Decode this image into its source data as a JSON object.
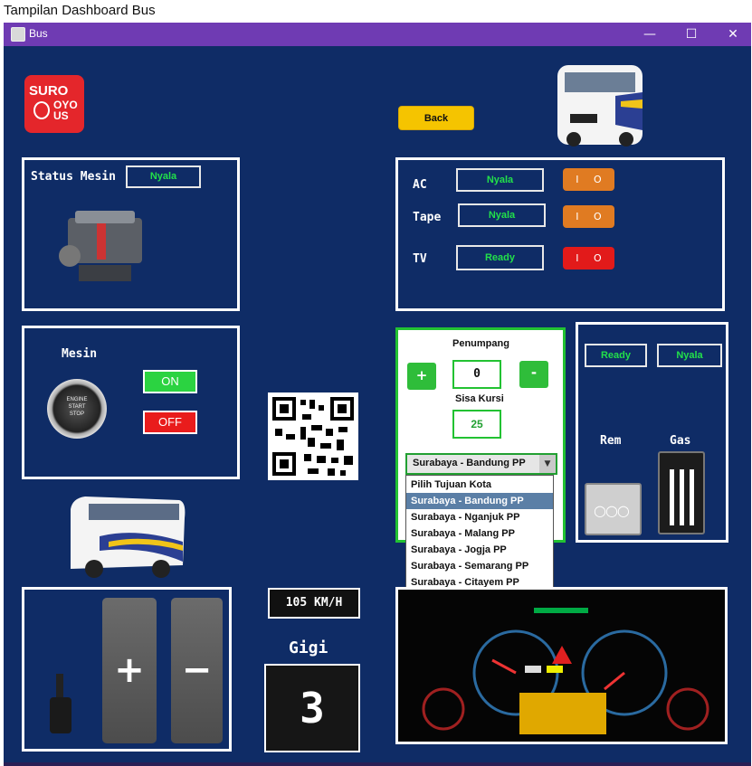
{
  "outer_title": "Tampilan Dashboard Bus",
  "window": {
    "title": "Bus",
    "minimize": "—",
    "maximize": "☐",
    "close": "✕"
  },
  "logo": {
    "line1": "SURO",
    "line2": "OYO",
    "line3": "US"
  },
  "back_label": "Back",
  "status_mesin": {
    "label": "Status Mesin",
    "value": "Nyala"
  },
  "accessories": [
    {
      "label": "AC",
      "value": "Nyala",
      "toggle_color": "#e07b22"
    },
    {
      "label": "Tape",
      "value": "Nyala",
      "toggle_color": "#e07b22"
    },
    {
      "label": "TV",
      "value": "Ready",
      "toggle_color": "#e21a1a"
    }
  ],
  "toggle_text": {
    "on": "I",
    "off": "O"
  },
  "mesin": {
    "label": "Mesin",
    "on": "ON",
    "off": "OFF",
    "knob_text1": "ENGINE",
    "knob_text2": "START",
    "knob_text3": "STOP"
  },
  "penumpang": {
    "label": "Penumpang",
    "plus": "+",
    "minus": "-",
    "count": "0",
    "sisa_label": "Sisa Kursi",
    "sisa_value": "25",
    "selected_route": "Surabaya - Bandung PP",
    "routes": [
      "Pilih Tujuan Kota",
      "Surabaya - Bandung PP",
      "Surabaya - Nganjuk PP",
      "Surabaya - Malang PP",
      "Surabaya - Jogja PP",
      "Surabaya - Semarang PP",
      "Surabaya - Citayem PP"
    ]
  },
  "pedals": {
    "status1": "Ready",
    "status2": "Nyala",
    "rem": "Rem",
    "gas": "Gas"
  },
  "speed": "105 KM/H",
  "gigi": {
    "label": "Gigi",
    "value": "3"
  },
  "gear_buttons": {
    "plus": "+",
    "minus": "−"
  },
  "colors": {
    "panel": "#0f2c66",
    "accent_green": "#22e04a",
    "titlebar": "#6f3bb3"
  }
}
